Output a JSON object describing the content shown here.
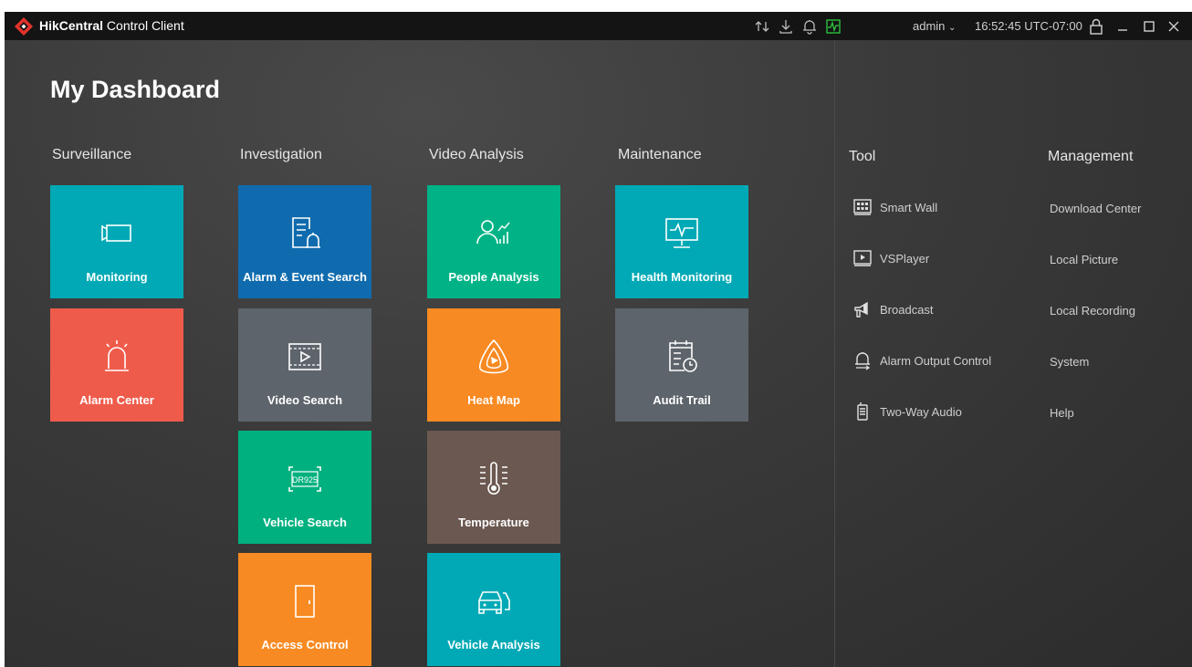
{
  "titlebar": {
    "brand": "HikCentral",
    "title_rest": " Control Client",
    "user": "admin",
    "clock": "16:52:45 UTC-07:00",
    "icons": [
      "transfer-icon",
      "download-icon",
      "bell-icon",
      "health-status-icon",
      "lock-icon",
      "minimize-icon",
      "maximize-icon",
      "close-icon"
    ]
  },
  "page_title": "My Dashboard",
  "categories": {
    "surveillance": "Surveillance",
    "investigation": "Investigation",
    "video_analysis": "Video Analysis",
    "maintenance": "Maintenance"
  },
  "tiles": {
    "monitoring": {
      "label": "Monitoring",
      "color": "#00a9b5"
    },
    "alarm_center": {
      "label": "Alarm Center",
      "color": "#ef5b4b"
    },
    "alarm_event_search": {
      "label": "Alarm & Event Search",
      "color": "#0f6bad"
    },
    "video_search": {
      "label": "Video Search",
      "color": "#5e646b"
    },
    "vehicle_search": {
      "label": "Vehicle Search",
      "color": "#00b07f",
      "plate": "DR925"
    },
    "access_control": {
      "label": "Access Control",
      "color": "#f78a22"
    },
    "people_analysis": {
      "label": "People Analysis",
      "color": "#00b386"
    },
    "heat_map": {
      "label": "Heat Map",
      "color": "#f78a22"
    },
    "temperature": {
      "label": "Temperature",
      "color": "#6b5851"
    },
    "vehicle_analysis": {
      "label": "Vehicle Analysis",
      "color": "#00a9b5"
    },
    "health_monitoring": {
      "label": "Health Monitoring",
      "color": "#00a9b5"
    },
    "audit_trail": {
      "label": "Audit Trail",
      "color": "#5e646b"
    }
  },
  "tool": {
    "heading": "Tool",
    "items": [
      "Smart Wall",
      "VSPlayer",
      "Broadcast",
      "Alarm Output Control",
      "Two-Way Audio"
    ]
  },
  "management": {
    "heading": "Management",
    "items": [
      "Download Center",
      "Local Picture",
      "Local Recording",
      "System",
      "Help"
    ]
  },
  "colors": {
    "accent_health": "#2ecc40",
    "titlebar_bg": "#141414"
  }
}
